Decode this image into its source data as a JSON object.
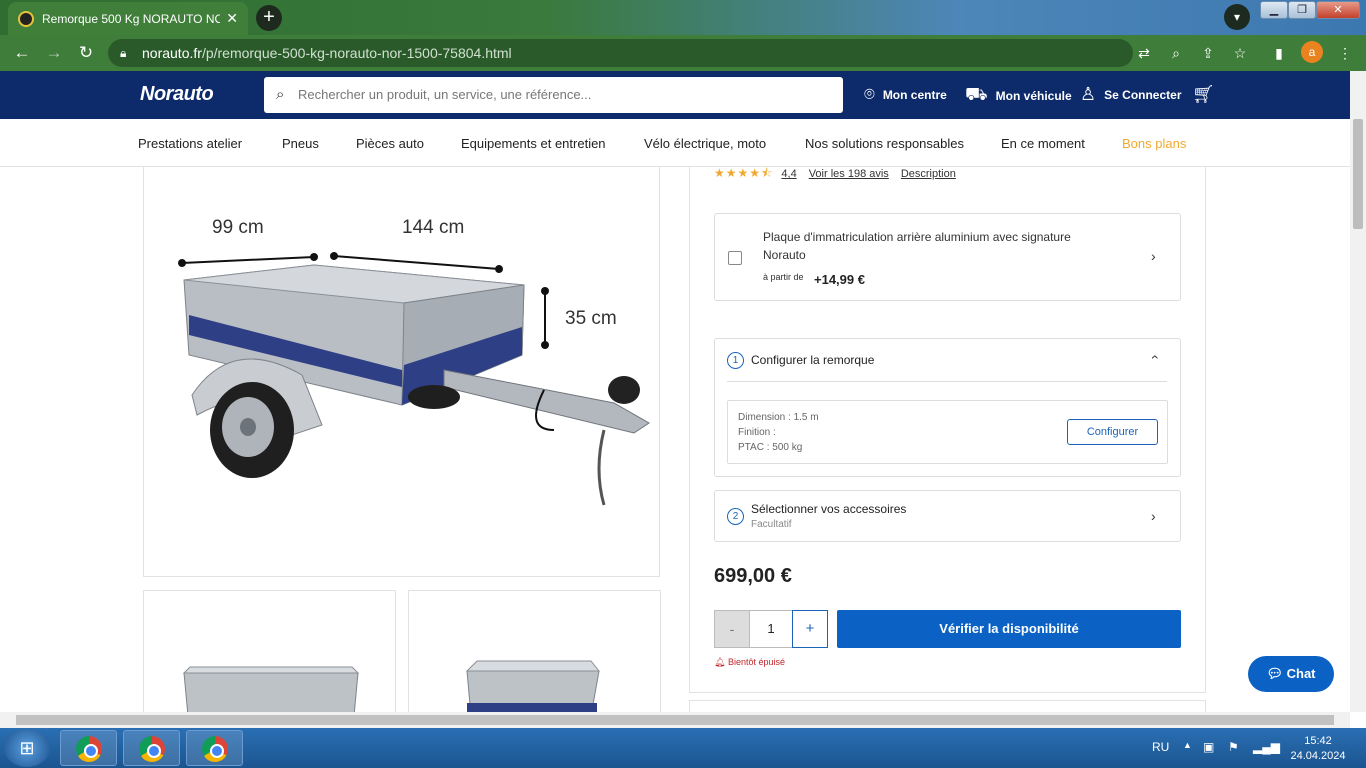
{
  "browser": {
    "tab_title": "Remorque 500 Kg NORAUTO NO",
    "tab_close": "✕",
    "new_tab": "+",
    "url_domain": "norauto.fr",
    "url_path": "/p/remorque-500-kg-norauto-nor-1500-75804.html",
    "profile_initial": "a"
  },
  "header": {
    "logo": "Norauto",
    "search_placeholder": "Rechercher un produit, un service, une référence...",
    "links": {
      "centre": "Mon centre",
      "vehicule": "Mon véhicule",
      "connect": "Se Connecter"
    }
  },
  "menu": {
    "items": [
      "Prestations atelier",
      "Pneus",
      "Pièces auto",
      "Equipements et entretien",
      "Vélo électrique, moto",
      "Nos solutions responsables",
      "En ce moment",
      "Bons plans"
    ]
  },
  "image": {
    "dims": {
      "width": "99 cm",
      "length": "144 cm",
      "height": "35 cm"
    }
  },
  "product": {
    "rating": 4.4,
    "rating_text": "4,4",
    "reviews_link": "Voir les 198 avis",
    "description_link": "Description",
    "addon": {
      "title": "Plaque d'immatriculation arrière aluminium avec signature Norauto",
      "price_prefix": "à partir de",
      "price": "+14,99 €",
      "checked": false
    },
    "step1": {
      "num": "1",
      "title": "Configurer la remorque",
      "dimension": "Dimension : 1.5 m",
      "finition": "Finition :",
      "ptac": "PTAC : 500 kg",
      "button": "Configurer"
    },
    "step2": {
      "num": "2",
      "title": "Sélectionner vos accessoires",
      "subtitle": "Facultatif"
    },
    "price": "699,00 €",
    "qty_minus": "-",
    "quantity": "1",
    "qty_plus": "+",
    "availability_button": "Vérifier la disponibilité",
    "stock_status": "Bientôt épuisé"
  },
  "chat": {
    "label": "Chat"
  },
  "taskbar": {
    "lang": "RU",
    "time": "15:42",
    "date": "24.04.2024"
  },
  "colors": {
    "header_bg": "#0d2b6b",
    "accent_blue": "#0b62c4",
    "bons_plans": "#f0a92e",
    "stock_red": "#c0282b"
  }
}
